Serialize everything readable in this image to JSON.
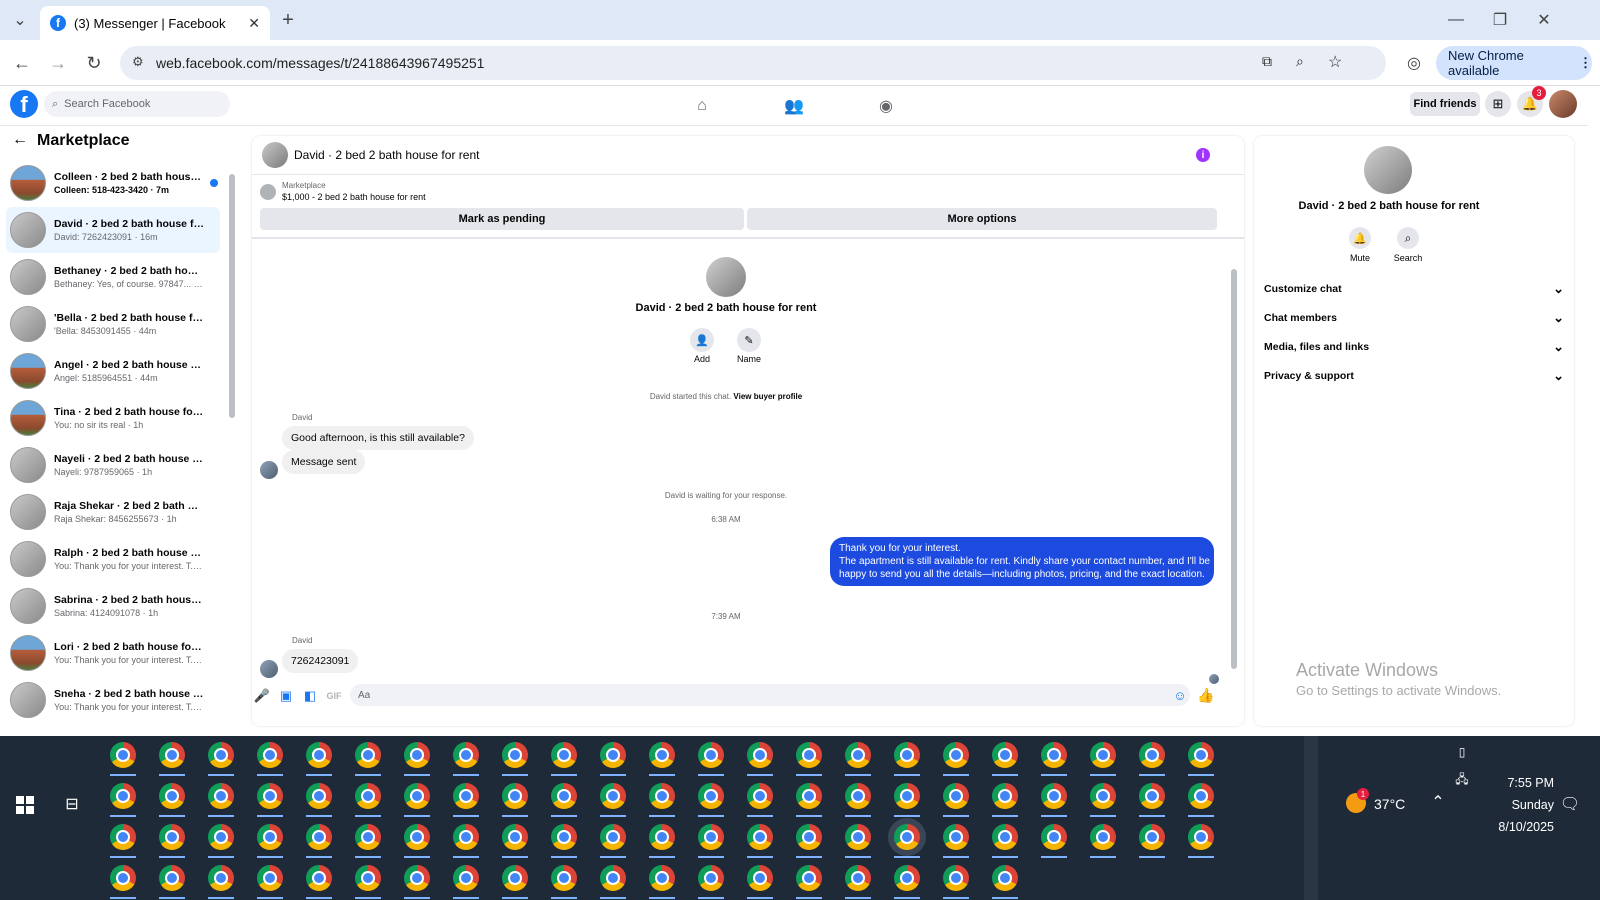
{
  "browser": {
    "tab_title": "(3) Messenger | Facebook",
    "url": "web.facebook.com/messages/t/24188643967495251",
    "new_chrome": "New Chrome available"
  },
  "fb": {
    "search_placeholder": "Search Facebook",
    "find_friends": "Find friends",
    "notif_count": "3"
  },
  "left": {
    "title": "Marketplace",
    "conversations": [
      {
        "name": "Colleen · 2 bed 2 bath house ...",
        "sub": "Colleen: 518-423-3420 · 7m",
        "unread": true
      },
      {
        "name": "David · 2 bed 2 bath house for ...",
        "sub": "David: 7262423091 · 16m",
        "unread": false
      },
      {
        "name": "Bethaney · 2 bed 2 bath house ...",
        "sub": "Bethaney: Yes, of course. 97847... · 30m",
        "unread": false
      },
      {
        "name": "'Bella · 2 bed 2 bath house for r...",
        "sub": "'Bella: 8453091455 · 44m",
        "unread": false
      },
      {
        "name": "Angel · 2 bed 2 bath house for ...",
        "sub": "Angel: 5185964551 · 44m",
        "unread": false
      },
      {
        "name": "Tina · 2 bed 2 bath house for...",
        "sub": "You: no sir its real · 1h",
        "unread": false
      },
      {
        "name": "Nayeli · 2 bed 2 bath house for...",
        "sub": "Nayeli: 9787959065 · 1h",
        "unread": false
      },
      {
        "name": "Raja Shekar · 2 bed 2 bath hou...",
        "sub": "Raja Shekar: 8456255673 · 1h",
        "unread": false
      },
      {
        "name": "Ralph · 2 bed 2 bath house for ...",
        "sub": "You: Thank you for your interest. T... · 1h",
        "unread": false
      },
      {
        "name": "Sabrina · 2 bed 2 bath house fo...",
        "sub": "Sabrina: 4124091078 · 1h",
        "unread": false
      },
      {
        "name": "Lori · 2 bed 2 bath house for rent",
        "sub": "You: Thank you for your interest. T... · 1h",
        "unread": false
      },
      {
        "name": "Sneha · 2 bed 2 bath house for ...",
        "sub": "You: Thank you for your interest. T... · 1h",
        "unread": false
      }
    ]
  },
  "chat": {
    "header": "David · 2 bed 2 bath house for rent",
    "market_label": "Marketplace",
    "listing": "$1,000 - 2 bed 2 bath house for rent",
    "mark_pending": "Mark as pending",
    "more_options": "More options",
    "profile_name": "David · 2 bed 2 bath house for rent",
    "add": "Add",
    "name_btn": "Name",
    "started": "David started this chat.",
    "view_profile": "View buyer profile",
    "sender1": "David",
    "msg1": "Good afternoon, is this still available?",
    "msg2": "Message sent",
    "waiting": "David is waiting for your response.",
    "time1": "6:38 AM",
    "reply_l1": "Thank you for your interest.",
    "reply_l2": "The apartment is still available for rent. Kindly share your contact number, and I'll be",
    "reply_l3": "happy to send you all the details—including photos, pricing, and the exact location.",
    "time2": "7:39 AM",
    "sender2": "David",
    "msg3": "7262423091",
    "input_placeholder": "Aa"
  },
  "right": {
    "name": "David · 2 bed 2 bath house for rent",
    "mute": "Mute",
    "search": "Search",
    "sections": [
      "Customize chat",
      "Chat members",
      "Media, files and links",
      "Privacy & support"
    ]
  },
  "watermark": {
    "line1": "Activate Windows",
    "line2": "Go to Settings to activate Windows."
  },
  "taskbar": {
    "temp": "37°C",
    "weather_badge": "1",
    "time": "7:55 PM",
    "day": "Sunday",
    "date": "8/10/2025"
  }
}
